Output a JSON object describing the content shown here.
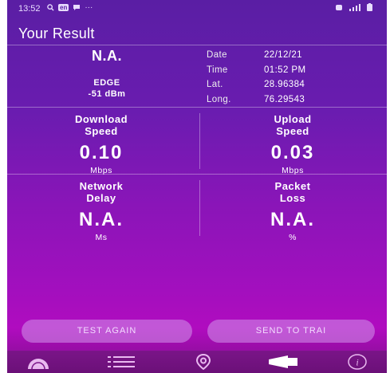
{
  "status": {
    "time": "13:52",
    "left_icons": [
      "search-icon",
      "app-badge",
      "chat-icon"
    ],
    "badge": "en",
    "more": "···",
    "right_icons": [
      "alarm-icon",
      "signal-icon",
      "battery-icon"
    ]
  },
  "title": "Your Result",
  "network": {
    "value": "N.A.",
    "type": "EDGE",
    "signal": "-51 dBm"
  },
  "meta": {
    "date_label": "Date",
    "date": "22/12/21",
    "time_label": "Time",
    "time": "01:52 PM",
    "lat_label": "Lat.",
    "lat": "28.96384",
    "long_label": "Long.",
    "long": "76.29543"
  },
  "download": {
    "label1": "Download",
    "label2": "Speed",
    "value": "0.10",
    "unit": "Mbps"
  },
  "upload": {
    "label1": "Upload",
    "label2": "Speed",
    "value": "0.03",
    "unit": "Mbps"
  },
  "delay": {
    "label1": "Network",
    "label2": "Delay",
    "value": "N.A.",
    "unit": "Ms"
  },
  "loss": {
    "label1": "Packet",
    "label2": "Loss",
    "value": "N.A.",
    "unit": "%"
  },
  "buttons": {
    "test_again": "TEST AGAIN",
    "send": "SEND TO TRAI"
  },
  "nav": [
    "speedometer-icon",
    "list-icon",
    "location-icon",
    "megaphone-icon",
    "info-icon"
  ],
  "colors": {
    "bg_top": "#5a1ea4",
    "bg_bottom": "#b00cbf",
    "button": "#d296eb"
  }
}
